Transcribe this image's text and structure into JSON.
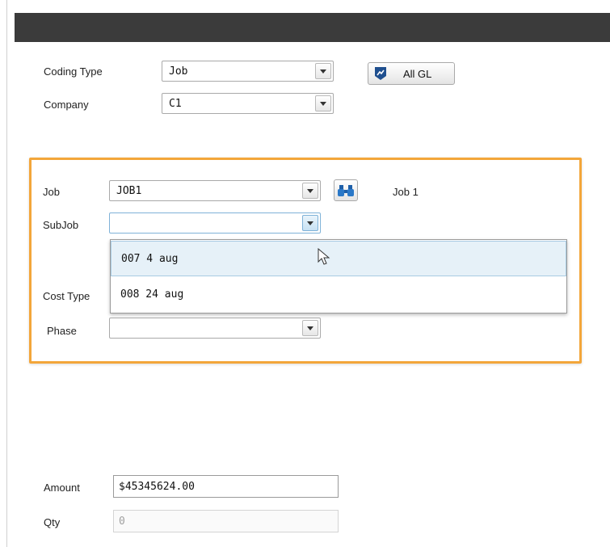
{
  "header": {
    "title": ""
  },
  "form": {
    "coding_type": {
      "label": "Coding Type",
      "value": "Job"
    },
    "company": {
      "label": "Company",
      "value": "C1"
    },
    "all_gl_button": {
      "label": "All GL"
    },
    "job": {
      "label": "Job",
      "value": "JOB1",
      "description": "Job 1"
    },
    "subjob": {
      "label": "SubJob",
      "value": ""
    },
    "subjob_options": [
      {
        "label": "007  4 aug"
      },
      {
        "label": "008  24 aug"
      }
    ],
    "cost_type": {
      "label": "Cost Type",
      "value": ""
    },
    "phase": {
      "label": "Phase",
      "value": ""
    },
    "amount": {
      "label": "Amount",
      "value": "$45345624.00"
    },
    "qty": {
      "label": "Qty",
      "value": "0"
    }
  },
  "colors": {
    "titlebar": "#3b3b3b",
    "highlight_border": "#f3a63a",
    "hover_row": "#e6f1f8"
  },
  "icons": [
    "chevron-down-icon",
    "chart-badge-icon",
    "binoculars-icon",
    "mouse-cursor-icon"
  ]
}
